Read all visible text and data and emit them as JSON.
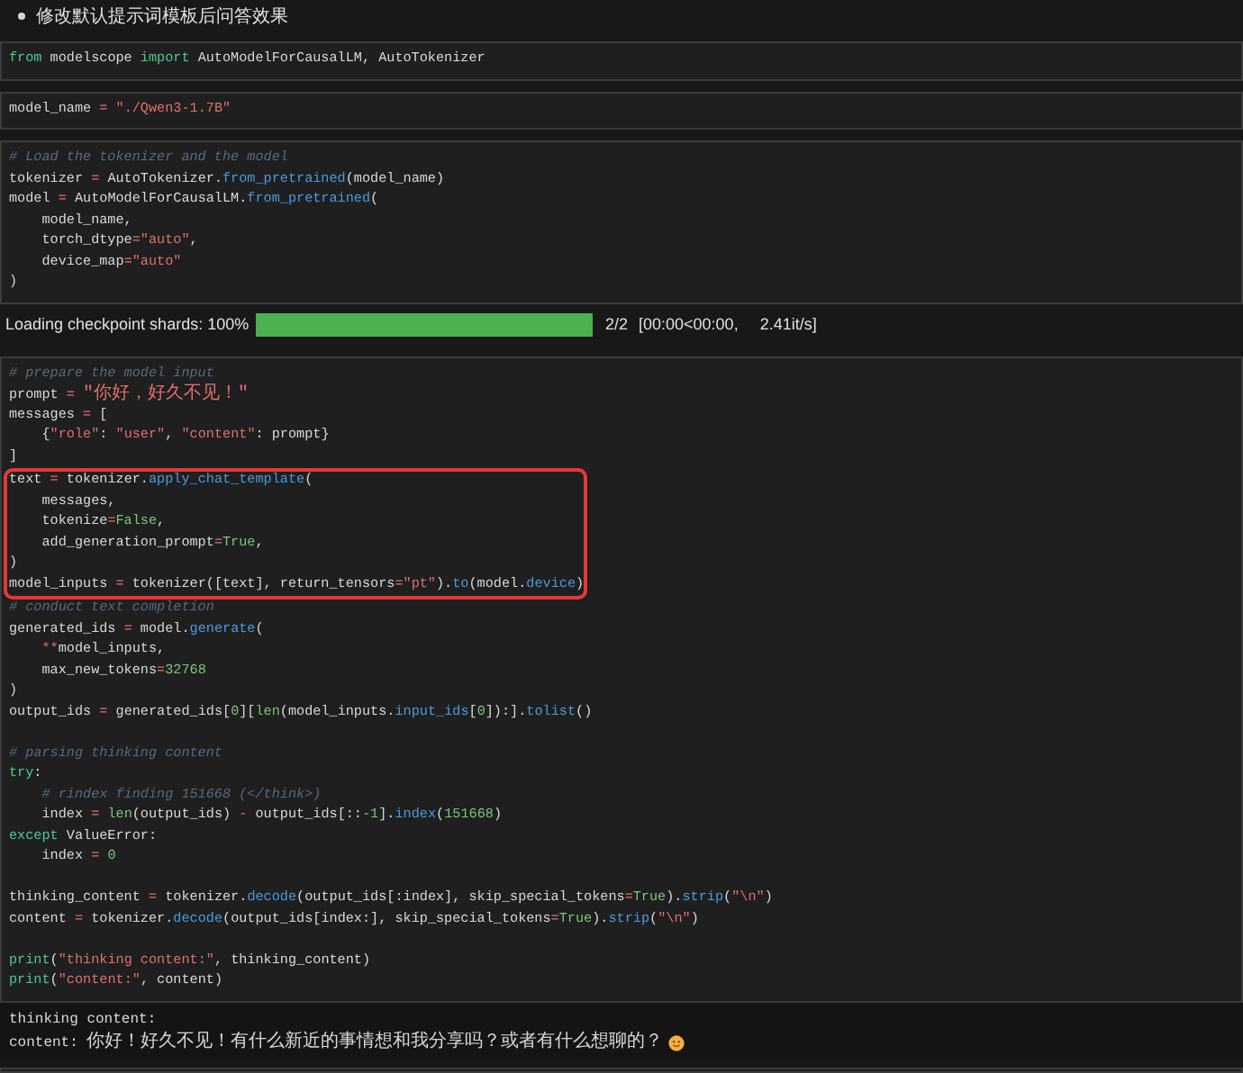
{
  "heading": "修改默认提示词模板后问答效果",
  "cells_before": [
    {
      "lines": [
        {
          "kind": "code",
          "tokens": [
            {
              "kind": "kw",
              "text": "from"
            },
            {
              "kind": "p",
              "text": " modelscope "
            },
            {
              "kind": "kw",
              "text": "import"
            },
            {
              "kind": "p",
              "text": " AutoModelForCausalLM, AutoTokenizer"
            }
          ]
        }
      ]
    },
    {
      "lines": [
        {
          "kind": "code",
          "tokens": [
            {
              "kind": "p",
              "text": "model_name "
            },
            {
              "kind": "op",
              "text": "= "
            },
            {
              "kind": "str",
              "text": "\"./Qwen3-1.7B\""
            }
          ]
        }
      ]
    },
    {
      "lines": [
        {
          "kind": "code",
          "tokens": [
            {
              "kind": "cmt",
              "text": "# Load the tokenizer and the model"
            }
          ]
        },
        {
          "kind": "code",
          "tokens": [
            {
              "kind": "p",
              "text": "tokenizer "
            },
            {
              "kind": "op",
              "text": "="
            },
            {
              "kind": "p",
              "text": " AutoTokenizer."
            },
            {
              "kind": "fn",
              "text": "from_pretrained"
            },
            {
              "kind": "p",
              "text": "(model_name)"
            }
          ]
        },
        {
          "kind": "code",
          "tokens": [
            {
              "kind": "p",
              "text": "model "
            },
            {
              "kind": "op",
              "text": "="
            },
            {
              "kind": "p",
              "text": " AutoModelForCausalLM."
            },
            {
              "kind": "fn",
              "text": "from_pretrained"
            },
            {
              "kind": "p",
              "text": "("
            }
          ]
        },
        {
          "kind": "code",
          "tokens": [
            {
              "kind": "p",
              "text": "    model_name,"
            }
          ]
        },
        {
          "kind": "code",
          "tokens": [
            {
              "kind": "p",
              "text": "    torch_dtype"
            },
            {
              "kind": "op",
              "text": "="
            },
            {
              "kind": "str",
              "text": "\"auto\""
            },
            {
              "kind": "p",
              "text": ","
            }
          ]
        },
        {
          "kind": "code",
          "tokens": [
            {
              "kind": "p",
              "text": "    device_map"
            },
            {
              "kind": "op",
              "text": "="
            },
            {
              "kind": "str",
              "text": "\"auto\""
            }
          ]
        },
        {
          "kind": "code",
          "tokens": [
            {
              "kind": "p",
              "text": ")"
            }
          ]
        }
      ]
    }
  ],
  "progress": {
    "label": "Loading checkpoint shards: 100%",
    "level": 1,
    "count": "2/2",
    "time": "[00:00<00:00,",
    "rate": "2.41it/s]"
  },
  "main_cell": {
    "lines": [
      {
        "kind": "code",
        "highlighted": false,
        "tokens": [
          {
            "kind": "cmt",
            "text": "# prepare the model input"
          }
        ]
      },
      {
        "kind": "code",
        "highlighted": false,
        "tokens": [
          {
            "kind": "p",
            "text": "prompt "
          },
          {
            "kind": "op",
            "text": "= "
          },
          {
            "kind": "zh",
            "text": "\"你好，好久不见！\""
          }
        ]
      },
      {
        "kind": "code",
        "highlighted": false,
        "tokens": [
          {
            "kind": "p",
            "text": "messages "
          },
          {
            "kind": "op",
            "text": "="
          },
          {
            "kind": "p",
            "text": " ["
          }
        ]
      },
      {
        "kind": "code",
        "highlighted": false,
        "tokens": [
          {
            "kind": "p",
            "text": "    {"
          },
          {
            "kind": "str",
            "text": "\"role\""
          },
          {
            "kind": "p",
            "text": ": "
          },
          {
            "kind": "str",
            "text": "\"user\""
          },
          {
            "kind": "p",
            "text": ", "
          },
          {
            "kind": "str",
            "text": "\"content\""
          },
          {
            "kind": "p",
            "text": ": prompt}"
          }
        ]
      },
      {
        "kind": "code",
        "highlighted": false,
        "tokens": [
          {
            "kind": "p",
            "text": "]"
          }
        ]
      },
      {
        "kind": "code",
        "highlighted": true,
        "tokens": [
          {
            "kind": "p",
            "text": "text "
          },
          {
            "kind": "op",
            "text": "="
          },
          {
            "kind": "p",
            "text": " tokenizer."
          },
          {
            "kind": "fn",
            "text": "apply_chat_template"
          },
          {
            "kind": "p",
            "text": "("
          }
        ]
      },
      {
        "kind": "code",
        "highlighted": true,
        "tokens": [
          {
            "kind": "p",
            "text": "    messages,"
          }
        ]
      },
      {
        "kind": "code",
        "highlighted": true,
        "tokens": [
          {
            "kind": "p",
            "text": "    tokenize"
          },
          {
            "kind": "op",
            "text": "="
          },
          {
            "kind": "num",
            "text": "False"
          },
          {
            "kind": "p",
            "text": ","
          }
        ]
      },
      {
        "kind": "code",
        "highlighted": true,
        "tokens": [
          {
            "kind": "p",
            "text": "    add_generation_prompt"
          },
          {
            "kind": "op",
            "text": "="
          },
          {
            "kind": "num",
            "text": "True"
          },
          {
            "kind": "p",
            "text": ","
          }
        ]
      },
      {
        "kind": "code",
        "highlighted": true,
        "tokens": [
          {
            "kind": "p",
            "text": ")"
          }
        ]
      },
      {
        "kind": "code",
        "highlighted": true,
        "tokens": [
          {
            "kind": "p",
            "text": "model_inputs "
          },
          {
            "kind": "op",
            "text": "="
          },
          {
            "kind": "p",
            "text": " tokenizer([text], return_tensors"
          },
          {
            "kind": "op",
            "text": "="
          },
          {
            "kind": "str",
            "text": "\"pt\""
          },
          {
            "kind": "p",
            "text": ")."
          },
          {
            "kind": "fn",
            "text": "to"
          },
          {
            "kind": "p",
            "text": "(model."
          },
          {
            "kind": "fn",
            "text": "device"
          },
          {
            "kind": "p",
            "text": ")"
          }
        ]
      },
      {
        "kind": "code",
        "highlighted": false,
        "tokens": [
          {
            "kind": "cmt",
            "text": "# conduct text completion"
          }
        ]
      },
      {
        "kind": "code",
        "highlighted": false,
        "tokens": [
          {
            "kind": "p",
            "text": "generated_ids "
          },
          {
            "kind": "op",
            "text": "="
          },
          {
            "kind": "p",
            "text": " model."
          },
          {
            "kind": "fn",
            "text": "generate"
          },
          {
            "kind": "p",
            "text": "("
          }
        ]
      },
      {
        "kind": "code",
        "highlighted": false,
        "tokens": [
          {
            "kind": "op",
            "text": "    **"
          },
          {
            "kind": "p",
            "text": "model_inputs,"
          }
        ]
      },
      {
        "kind": "code",
        "highlighted": false,
        "tokens": [
          {
            "kind": "p",
            "text": "    max_new_tokens"
          },
          {
            "kind": "op",
            "text": "="
          },
          {
            "kind": "num",
            "text": "32768"
          }
        ]
      },
      {
        "kind": "code",
        "highlighted": false,
        "tokens": [
          {
            "kind": "p",
            "text": ")"
          }
        ]
      },
      {
        "kind": "code",
        "highlighted": false,
        "tokens": [
          {
            "kind": "p",
            "text": "output_ids "
          },
          {
            "kind": "op",
            "text": "="
          },
          {
            "kind": "p",
            "text": " generated_ids["
          },
          {
            "kind": "num",
            "text": "0"
          },
          {
            "kind": "p",
            "text": "]["
          },
          {
            "kind": "num",
            "text": "len"
          },
          {
            "kind": "p",
            "text": "(model_inputs."
          },
          {
            "kind": "fn",
            "text": "input_ids"
          },
          {
            "kind": "p",
            "text": "["
          },
          {
            "kind": "num",
            "text": "0"
          },
          {
            "kind": "p",
            "text": "]):]."
          },
          {
            "kind": "fn",
            "text": "tolist"
          },
          {
            "kind": "p",
            "text": "()"
          }
        ]
      },
      {
        "kind": "blank"
      },
      {
        "kind": "code",
        "highlighted": false,
        "tokens": [
          {
            "kind": "cmt",
            "text": "# parsing thinking content"
          }
        ]
      },
      {
        "kind": "code",
        "highlighted": false,
        "tokens": [
          {
            "kind": "kw",
            "text": "try"
          },
          {
            "kind": "p",
            "text": ":"
          }
        ]
      },
      {
        "kind": "code",
        "highlighted": false,
        "tokens": [
          {
            "kind": "cmt",
            "text": "    # rindex finding 151668 (</think>)"
          }
        ]
      },
      {
        "kind": "code",
        "highlighted": false,
        "tokens": [
          {
            "kind": "p",
            "text": "    index "
          },
          {
            "kind": "op",
            "text": "= "
          },
          {
            "kind": "num",
            "text": "len"
          },
          {
            "kind": "p",
            "text": "(output_ids) "
          },
          {
            "kind": "op",
            "text": "-"
          },
          {
            "kind": "p",
            "text": " output_ids[::"
          },
          {
            "kind": "num",
            "text": "-1"
          },
          {
            "kind": "p",
            "text": "]."
          },
          {
            "kind": "fn",
            "text": "index"
          },
          {
            "kind": "p",
            "text": "("
          },
          {
            "kind": "num",
            "text": "151668"
          },
          {
            "kind": "p",
            "text": ")"
          }
        ]
      },
      {
        "kind": "code",
        "highlighted": false,
        "tokens": [
          {
            "kind": "kw",
            "text": "except"
          },
          {
            "kind": "p",
            "text": " ValueError:"
          }
        ]
      },
      {
        "kind": "code",
        "highlighted": false,
        "tokens": [
          {
            "kind": "p",
            "text": "    index "
          },
          {
            "kind": "op",
            "text": "= "
          },
          {
            "kind": "num",
            "text": "0"
          }
        ]
      },
      {
        "kind": "blank"
      },
      {
        "kind": "code",
        "highlighted": false,
        "tokens": [
          {
            "kind": "p",
            "text": "thinking_content "
          },
          {
            "kind": "op",
            "text": "="
          },
          {
            "kind": "p",
            "text": " tokenizer."
          },
          {
            "kind": "fn",
            "text": "decode"
          },
          {
            "kind": "p",
            "text": "(output_ids[:index], skip_special_tokens"
          },
          {
            "kind": "op",
            "text": "="
          },
          {
            "kind": "num",
            "text": "True"
          },
          {
            "kind": "p",
            "text": ")."
          },
          {
            "kind": "fn",
            "text": "strip"
          },
          {
            "kind": "p",
            "text": "("
          },
          {
            "kind": "str",
            "text": "\"\\n\""
          },
          {
            "kind": "p",
            "text": ")"
          }
        ]
      },
      {
        "kind": "code",
        "highlighted": false,
        "tokens": [
          {
            "kind": "p",
            "text": "content "
          },
          {
            "kind": "op",
            "text": "="
          },
          {
            "kind": "p",
            "text": " tokenizer."
          },
          {
            "kind": "fn",
            "text": "decode"
          },
          {
            "kind": "p",
            "text": "(output_ids[index:], skip_special_tokens"
          },
          {
            "kind": "op",
            "text": "="
          },
          {
            "kind": "num",
            "text": "True"
          },
          {
            "kind": "p",
            "text": ")."
          },
          {
            "kind": "fn",
            "text": "strip"
          },
          {
            "kind": "p",
            "text": "("
          },
          {
            "kind": "str",
            "text": "\"\\n\""
          },
          {
            "kind": "p",
            "text": ")"
          }
        ]
      },
      {
        "kind": "blank"
      },
      {
        "kind": "code",
        "highlighted": false,
        "tokens": [
          {
            "kind": "kw",
            "text": "print"
          },
          {
            "kind": "p",
            "text": "("
          },
          {
            "kind": "str",
            "text": "\"thinking content:\""
          },
          {
            "kind": "p",
            "text": ", thinking_content)"
          }
        ]
      },
      {
        "kind": "code",
        "highlighted": false,
        "tokens": [
          {
            "kind": "kw",
            "text": "print"
          },
          {
            "kind": "p",
            "text": "("
          },
          {
            "kind": "str",
            "text": "\"content:\""
          },
          {
            "kind": "p",
            "text": ", content)"
          }
        ]
      }
    ]
  },
  "output": [
    {
      "tokens": [
        {
          "kind": "p",
          "text": "thinking content:"
        }
      ]
    },
    {
      "tokens": [
        {
          "kind": "p",
          "text": "content: "
        },
        {
          "kind": "zh",
          "text": "你好！好久不见！有什么新近的事情想和我分享吗？或者有什么想聊的？"
        }
      ]
    }
  ]
}
